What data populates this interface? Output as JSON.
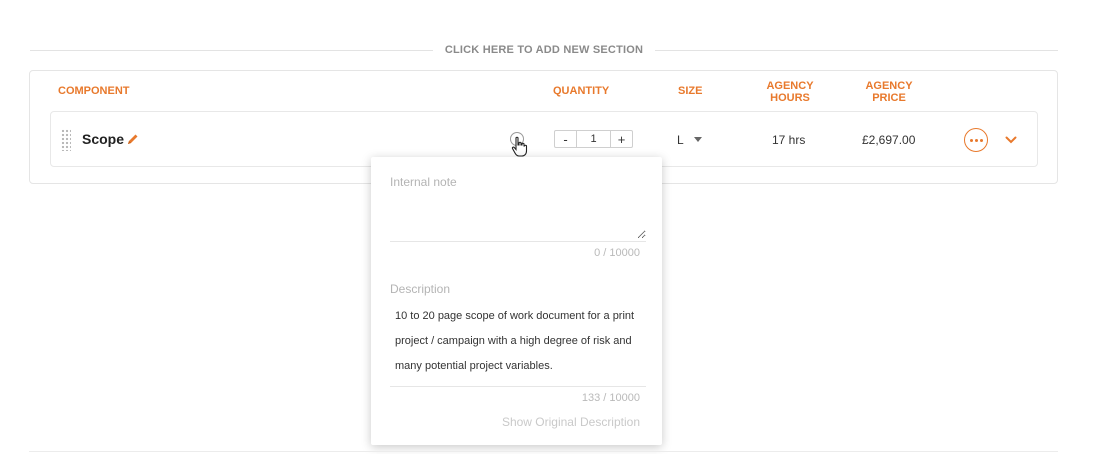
{
  "add_section": {
    "label": "CLICK HERE TO ADD NEW SECTION"
  },
  "columns": {
    "component": "COMPONENT",
    "quantity": "QUANTITY",
    "size": "SIZE",
    "agency_hours": "AGENCY\nHOURS",
    "agency_price": "AGENCY\nPRICE"
  },
  "row": {
    "name": "Scope",
    "quantity": "1",
    "minus": "-",
    "plus": "+",
    "size": "L",
    "hours": "17 hrs",
    "price": "£2,697.00"
  },
  "popover": {
    "note_label": "Internal note",
    "note_value": "",
    "note_counter": "0 / 10000",
    "description_label": "Description",
    "description": "10 to 20 page scope of work document for a print project / campaign with a high degree of risk and many potential project variables.",
    "description_counter": "133 / 10000",
    "show_original": "Show Original Description"
  },
  "colors": {
    "accent": "#e8792c",
    "muted_text": "#8a8a8a",
    "border": "#e5e5e5"
  },
  "icons": {
    "drag": "drag-handle-icon",
    "edit": "pencil-icon",
    "info": "info-icon",
    "pointer": "hand-cursor-icon",
    "more": "more-horizontal-icon",
    "expand": "chevron-down-icon",
    "size_caret": "caret-down-icon"
  }
}
